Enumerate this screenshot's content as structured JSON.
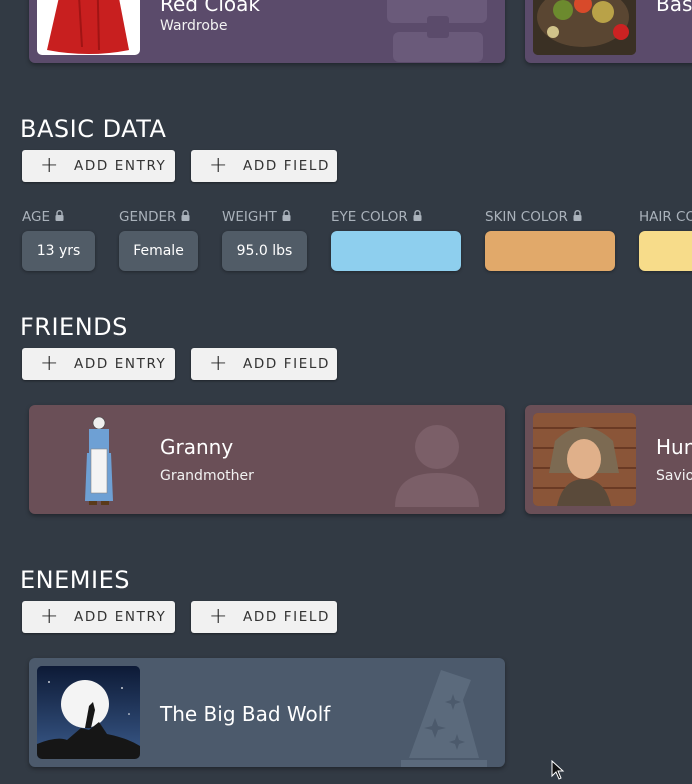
{
  "inventory": {
    "cards": [
      {
        "title": "Red Cloak",
        "subtitle": "Wardrobe",
        "color": "#5b4b6b",
        "bg_icon": "treasure-chest-icon"
      },
      {
        "title": "Basket",
        "subtitle": "",
        "color": "#5b4b6b",
        "bg_icon": "none"
      }
    ]
  },
  "basic_data": {
    "title": "BASIC DATA",
    "add_entry_label": "ADD ENTRY",
    "add_field_label": "ADD FIELD",
    "fields": [
      {
        "label": "AGE",
        "value": "13 yrs",
        "locked": true
      },
      {
        "label": "GENDER",
        "value": "Female",
        "locked": true
      },
      {
        "label": "WEIGHT",
        "value": "95.0 lbs",
        "locked": true
      },
      {
        "label": "EYE COLOR",
        "swatch": "#8ecfee",
        "locked": true
      },
      {
        "label": "SKIN COLOR",
        "swatch": "#e1a96a",
        "locked": true
      },
      {
        "label": "HAIR CO",
        "swatch": "#f7dc8a",
        "locked": true
      }
    ]
  },
  "friends": {
    "title": "FRIENDS",
    "add_entry_label": "ADD ENTRY",
    "add_field_label": "ADD FIELD",
    "cards": [
      {
        "title": "Granny",
        "subtitle": "Grandmother",
        "color": "#6a4f57",
        "bg_icon": "person-icon"
      },
      {
        "title": "Hun",
        "subtitle": "Savio",
        "color": "#6a4f57",
        "bg_icon": "none"
      }
    ]
  },
  "enemies": {
    "title": "ENEMIES",
    "add_entry_label": "ADD ENTRY",
    "add_field_label": "ADD FIELD",
    "cards": [
      {
        "title": "The Big Bad Wolf",
        "subtitle": "",
        "color": "#4c5a6c",
        "bg_icon": "wizard-hat-icon"
      }
    ]
  },
  "colors": {
    "background": "#323a44",
    "button_bg": "#f1f1f1",
    "chip_bg": "#515c67",
    "label_color": "#aab2bb"
  }
}
